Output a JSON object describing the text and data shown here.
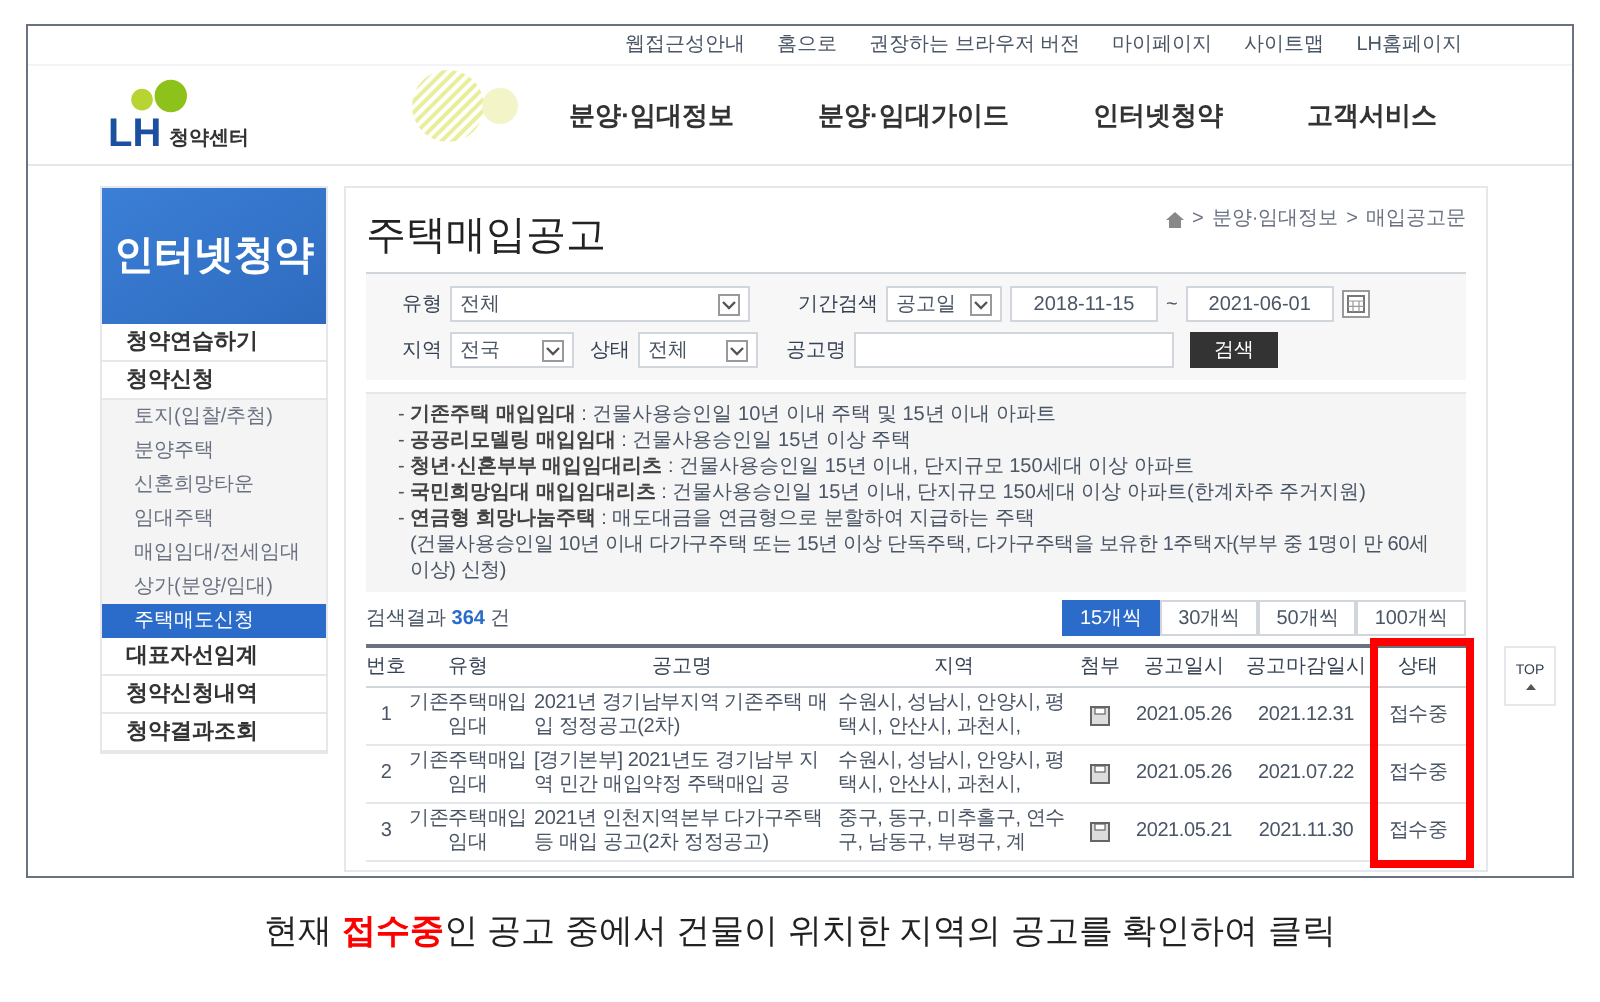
{
  "top_links": [
    "웹접근성안내",
    "홈으로",
    "권장하는 브라우저 버전",
    "마이페이지",
    "사이트맵",
    "LH홈페이지"
  ],
  "logo": {
    "mark": "LH",
    "text": "청약센터"
  },
  "nav": [
    "분양·임대정보",
    "분양·임대가이드",
    "인터넷청약",
    "고객서비스"
  ],
  "sidebar": {
    "title": "인터넷청약",
    "items": [
      {
        "label": "청약연습하기",
        "kind": "main",
        "selected": false
      },
      {
        "label": "청약신청",
        "kind": "main",
        "selected": false
      },
      {
        "label": "토지(입찰/추첨)",
        "kind": "sub",
        "selected": false
      },
      {
        "label": "분양주택",
        "kind": "sub",
        "selected": false
      },
      {
        "label": "신혼희망타운",
        "kind": "sub",
        "selected": false
      },
      {
        "label": "임대주택",
        "kind": "sub",
        "selected": false
      },
      {
        "label": "매입임대/전세임대",
        "kind": "sub",
        "selected": false
      },
      {
        "label": "상가(분양/임대)",
        "kind": "sub",
        "selected": false
      },
      {
        "label": "주택매도신청",
        "kind": "sub",
        "selected": true
      },
      {
        "label": "대표자선임계",
        "kind": "main",
        "selected": false
      },
      {
        "label": "청약신청내역",
        "kind": "main",
        "selected": false
      },
      {
        "label": "청약결과조회",
        "kind": "main",
        "selected": false
      }
    ]
  },
  "breadcrumb": {
    "separator": ">",
    "items": [
      "분양·임대정보",
      "매입공고문"
    ]
  },
  "page_title": "주택매입공고",
  "filters": {
    "type": {
      "label": "유형",
      "value": "전체"
    },
    "period": {
      "label": "기간검색",
      "value": "공고일",
      "from": "2018-11-15",
      "separator": "~",
      "to": "2021-06-01"
    },
    "region": {
      "label": "지역",
      "value": "전국"
    },
    "status": {
      "label": "상태",
      "value": "전체"
    },
    "name": {
      "label": "공고명"
    },
    "search_button": "검색"
  },
  "notes": [
    "- **기존주택 매입임대** : 건물사용승인일 10년 이내 주택 및 15년 이내 아파트",
    "- **공공리모델링 매입임대** : 건물사용승인일 15년 이상 주택",
    "- **청년·신혼부부 매입임대리츠** : 건물사용승인일 15년 이내, 단지규모 150세대 이상 아파트",
    "- **국민희망임대 매입임대리츠** : 건물사용승인일 15년 이내, 단지규모 150세대 이상 아파트(한계차주 주거지원)",
    "- **연금형 희망나눔주택** : 매도대금을 연금형으로 분할하여 지급하는 주택"
  ],
  "note_detail": "(건물사용승인일 10년 이내 다가구주택 또는 15년 이상 단독주택, 다가구주택을 보유한 1주택자(부부 중 1명이 만 60세 이상) 신청)",
  "result_count": "검색결과 **364** 건",
  "page_sizes": [
    {
      "label": "15개씩",
      "selected": true
    },
    {
      "label": "30개씩",
      "selected": false
    },
    {
      "label": "50개씩",
      "selected": false
    },
    {
      "label": "100개씩",
      "selected": false
    }
  ],
  "top_button": "TOP",
  "table": {
    "columns": [
      "번호",
      "유형",
      "공고명",
      "지역",
      "첨부",
      "공고일시",
      "공고마감일시",
      "상태"
    ],
    "rows": [
      {
        "no": "1",
        "type": "기존주택매입 임대",
        "title": "2021년 경기남부지역 기존주택 매입 정정공고(2차)",
        "region": "수원시, 성남시, 안양시, 평택시, 안산시, 과천시,",
        "attachment": true,
        "posted": "2021.05.26",
        "deadline": "2021.12.31",
        "status": "접수중"
      },
      {
        "no": "2",
        "type": "기존주택매입 임대",
        "title": "[경기본부] 2021년도 경기남부 지역 민간 매입약정 주택매입 공",
        "region": "수원시, 성남시, 안양시, 평택시, 안산시, 과천시,",
        "attachment": true,
        "posted": "2021.05.26",
        "deadline": "2021.07.22",
        "status": "접수중"
      },
      {
        "no": "3",
        "type": "기존주택매입 임대",
        "title": "2021년 인천지역본부 다가구주택 등 매입 공고(2차 정정공고)",
        "region": "중구, 동구, 미추홀구, 연수구, 남동구, 부평구, 계",
        "attachment": true,
        "posted": "2021.05.21",
        "deadline": "2021.11.30",
        "status": "접수중"
      }
    ],
    "highlight_column": true
  },
  "caption": "현재 **접수중**인 공고 중에서 건물이 위치한 지역의 공고를 확인하여 클릭"
}
